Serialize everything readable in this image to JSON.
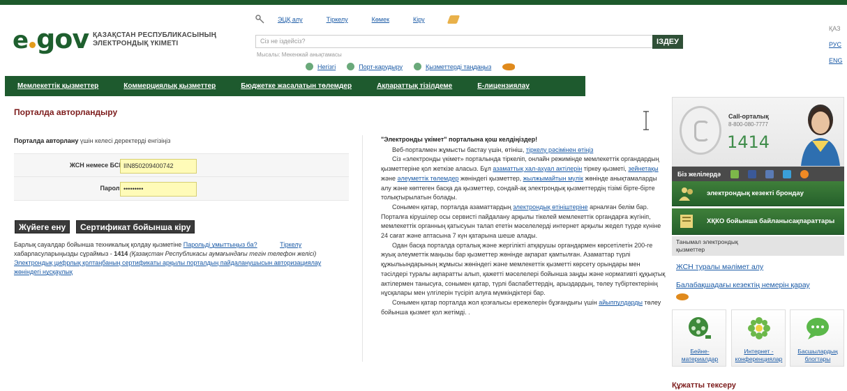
{
  "header": {
    "logo_e": "e",
    "logo_gov": "gov",
    "logo_text_line1": "ҚАЗАҚСТАН РЕСПУБЛИКАСЫНЫҢ",
    "logo_text_line2": "ЭЛЕКТРОНДЫҚ ҮКІМЕТІ",
    "top_links": [
      "ЭЦҚ алу",
      "Тіркелу",
      "Көмек",
      "Кіру"
    ],
    "search_placeholder": "Сіз не іздейсіз?",
    "search_button": "ІЗДЕУ",
    "search_hint": "Мысалы: Мекенжай анықтамасы",
    "quick_links": [
      "Негізгі",
      "Порт-карудыру",
      "Қызметтерді таңдаңыз"
    ],
    "languages": [
      "ҚАЗ",
      "РУС",
      "ENG"
    ]
  },
  "nav": {
    "items": [
      "Мемлекеттік қызметтер",
      "Коммерциялық қызметтер",
      "Бюджетке жасалатын төлемдер",
      "Ақпараттық тізілдеме",
      "Е-лицензиялау"
    ]
  },
  "login": {
    "title": "Порталда авторландыру",
    "intro_bold": "Порталда авторлану",
    "intro_rest": " үшін келесі деректерді енгізіңіз",
    "iin_label": "ЖСН немесе БСН:",
    "iin_value": "IIN850209400742",
    "password_label": "Пароль:",
    "password_value": "•••••••••",
    "enter_button": "Жүйеге ену",
    "cert_button": "Сертификат бойынша кіру",
    "help_text_1": "Барлық сауалдар бойынша техникалық қолдау қызметіне ",
    "forgot_link": "Парольді ұмыттыңыз ба?",
    "register_link": "Тіркелу",
    "help_text_2": "хабарласуларыңызды сұраймыз - ",
    "help_phone": "1414",
    "help_text_3": " (Қазақстан Республикасы аумағындағы тегін телефон желісі)",
    "guide_link": "Электрондық цифрлық қолтаңбаның сертификаты арқылы порталдың пайдаланушысын авторизациялау жөніндегі нұсқаулық"
  },
  "welcome": {
    "title": "\"Электронды үкімет\" порталына қош келдіңіздер!",
    "p1_text": "Веб-порталмен жұмысты бастау үшін, өтініш, ",
    "p1_link": "тіркелу рәсімінен өтіңіз",
    "p2_text_a": "Сіз «электронды үкімет» порталында тіркеліп, онлайн режимінде мемлекеттік органдардың қызметтеріне қол жеткізе аласыз. Бұл ",
    "p2_link_a": "азаматтық хал-ахуал актілерін",
    "p2_text_b": " тіркеу қызметі, ",
    "p2_link_b": "зейнетақы",
    "p2_text_c": " және ",
    "p2_link_c": "әлеуметтік төлемдер",
    "p2_text_d": " жөніндегі қызметтер, ",
    "p2_link_d": "жылжымайтын мүлік",
    "p2_text_e": " жөнінде анықтамаларды алу және көптеген басқа да қызметтер, сондай-ақ электрондық қызметтердің тізімі бірте-бірте толықтырылатын болады.",
    "p3_text_a": "Сонымен қатар, порталда азаматтардың ",
    "p3_link": "электрондық өтініштеріне",
    "p3_text_b": " арналған белім бар. Порталға кірушілер осы сервисті пайдалану арқылы тікелей мемлекеттік органдарға жүгініп, мемлекеттік органның қатысуын талап ететін мәселелерді интернет арқылы жедел түрде күніне 24 сағат және аптасына 7 күн қатарына шеше алады.",
    "p4_text": "Одан басқа порталда орталық және жергілікті атқарушы органдармен көрсетілетін 200-ге жуық әлеуметтік маңызы бар қызметтер жөнінде ақпарат қамтылған. Азаматтар түрлі құжыльындарының жұмысы жөніндегі және мемлекеттік қызметті көрсету орындары мен тәсілдері туралы ақпаратты алып, қажетті мәселелері бойынша заңды және нормативті құқықтық актілермен танысуға, сонымен қатар, түрлі баспабеттердің, арыздардың, төлеу түбіртектерінің нұсқалары мен үлгілерін түсіріп алуға мүмкіндіктері бар.",
    "p5_text_a": "Сонымен қатар порталда жол қозғалысы ережелерін бұзғандығы үшін ",
    "p5_link": "айыппұлдарды",
    "p5_text_b": " төлеу бойынша қызмет қол жетімді. ."
  },
  "right": {
    "call_title": "Call-орталық",
    "call_num": "8-800-080-7777",
    "call_big": "1414",
    "social_title": "Біз желілердә",
    "btn1": "электрондық кезекті брондау",
    "btn2_line1": "ХҚКО бойынша байланыс",
    "btn2_line2": "ақпараттары",
    "subhead_line1": "Танымал электрондық",
    "subhead_line2": "қызметтер",
    "link1": "ЖСН туралы мәлімет алу",
    "link2": "Балабақшадағы кезектің немерін қарау",
    "tile1_line1": "Бейне-",
    "tile1_line2": "материалдар",
    "tile2_line1": "Интернет -",
    "tile2_line2": "конференциялар",
    "tile3_line1": "Басшылардың",
    "tile3_line2": "блогтары",
    "doc_check": "Құжатты тексеру"
  },
  "colors": {
    "brand_green": "#1e5a2e",
    "title_red": "#7c1b1b",
    "link_blue": "#1a5aa6",
    "input_yellow": "#fffbb8"
  }
}
